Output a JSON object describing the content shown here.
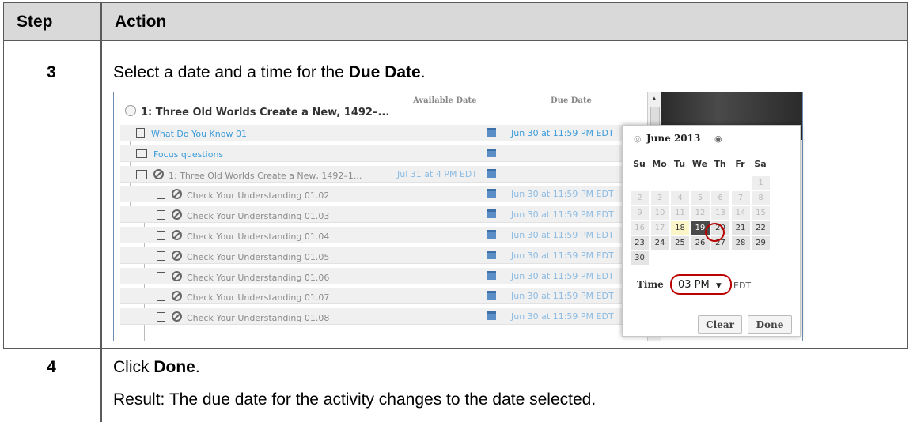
{
  "table": {
    "headers": {
      "step": "Step",
      "action": "Action"
    },
    "rows": [
      {
        "step": "3",
        "text_before": "Select a date and a time for the ",
        "bold": "Due Date",
        "text_after": "."
      },
      {
        "step": "4",
        "text_before": "Click ",
        "bold": "Done",
        "text_after": ".",
        "result": "Result: The due date for the activity changes to the date selected."
      }
    ]
  },
  "screenshot": {
    "col_available": "Available Date",
    "col_due": "Due Date",
    "unit_title": "1: Three Old Worlds Create a New, 1492–...",
    "items": [
      {
        "name": "What Do You Know 01",
        "due": "Jun 30 at 11:59 PM EDT",
        "icon": "doc-icon",
        "link": true
      },
      {
        "name": "Focus questions",
        "due": "",
        "icon": "book-icon",
        "link": true
      },
      {
        "name": "1: Three Old Worlds Create a New, 1492–1...",
        "available": "Jul 31 at 4 PM EDT",
        "due": "",
        "icon": "book-icon",
        "link": false
      },
      {
        "name": "Check Your Understanding 01.02",
        "due": "Jun 30 at 11:59 PM EDT",
        "icon": "doc-icon",
        "link": false
      },
      {
        "name": "Check Your Understanding 01.03",
        "due": "Jun 30 at 11:59 PM EDT",
        "icon": "doc-icon",
        "link": false
      },
      {
        "name": "Check Your Understanding 01.04",
        "due": "Jun 30 at 11:59 PM EDT",
        "icon": "doc-icon",
        "link": false
      },
      {
        "name": "Check Your Understanding 01.05",
        "due": "Jun 30 at 11:59 PM EDT",
        "icon": "doc-icon",
        "link": false
      },
      {
        "name": "Check Your Understanding 01.06",
        "due": "Jun 30 at 11:59 PM EDT",
        "icon": "doc-icon",
        "link": false
      },
      {
        "name": "Check Your Understanding 01.07",
        "due": "Jun 30 at 11:59 PM EDT",
        "icon": "doc-icon",
        "link": false
      },
      {
        "name": "Check Your Understanding 01.08",
        "due": "Jun 30 at 11:59 PM EDT",
        "icon": "doc-icon",
        "link": false
      }
    ],
    "calendar": {
      "month": "June 2013",
      "days_of_week": [
        "Su",
        "Mo",
        "Tu",
        "We",
        "Th",
        "Fr",
        "Sa"
      ],
      "first_weekday": 6,
      "num_days": 30,
      "today": 18,
      "selected": 19,
      "first_active": 18,
      "time_label": "Time",
      "time_value": "03 PM",
      "timezone": "EDT",
      "clear_label": "Clear",
      "done_label": "Done"
    }
  },
  "colors": {
    "header_bg": "#d9d9d9",
    "link": "#3a9bd9",
    "highlight_ring": "#b00000",
    "selected_day": "#4a4a4a"
  }
}
